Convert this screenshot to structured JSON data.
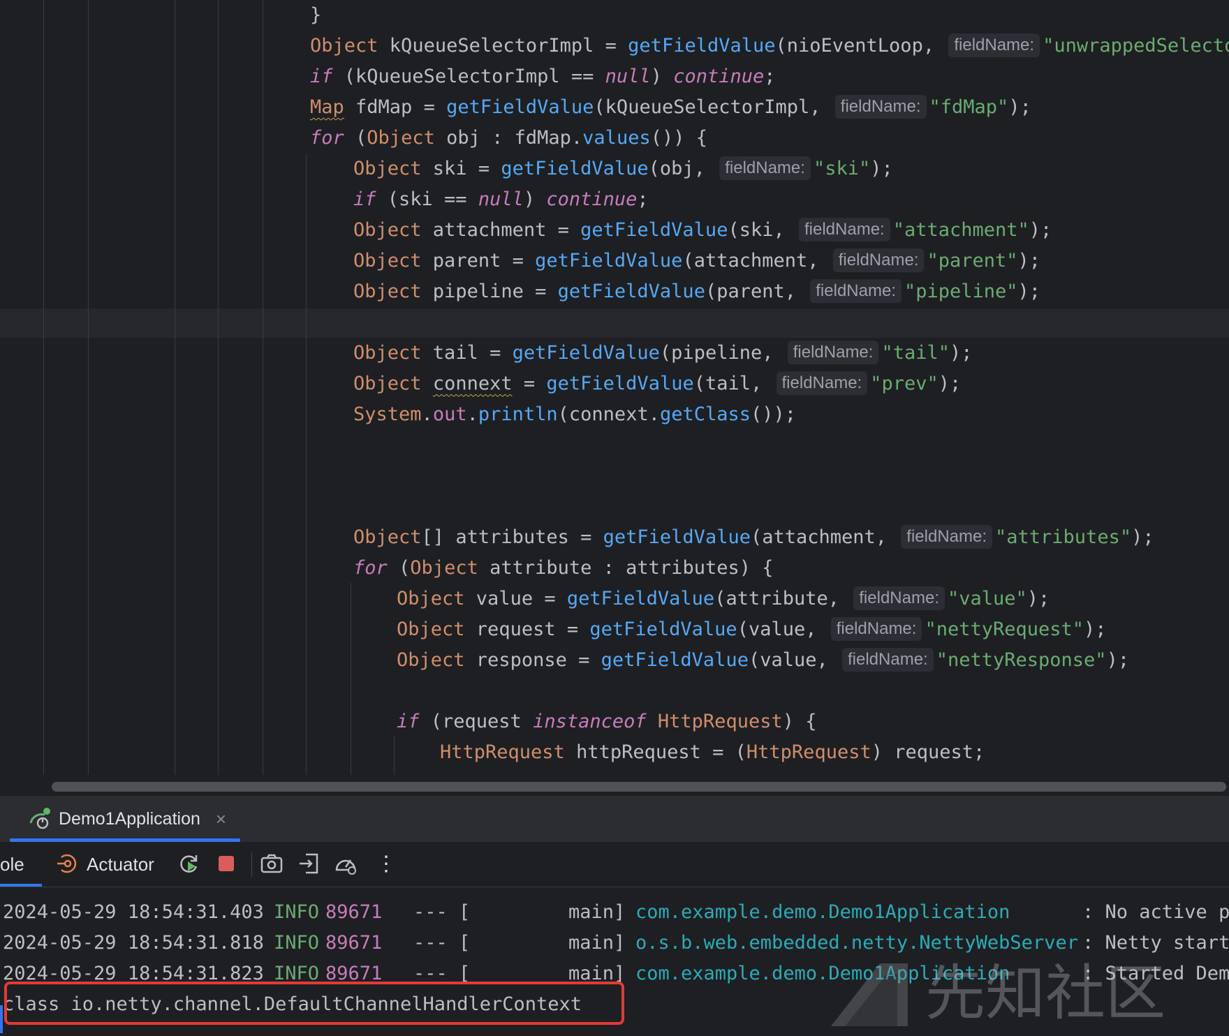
{
  "editor": {
    "lines": [
      [
        {
          "t": "}"
        }
      ],
      [
        {
          "c": "kw",
          "t": "Object"
        },
        {
          "t": " kQueueSelectorImpl = "
        },
        {
          "c": "fn",
          "t": "getFieldValue"
        },
        {
          "t": "(nioEventLoop, "
        },
        {
          "h": "fieldName:"
        },
        {
          "c": "str",
          "t": "\"unwrappedSelector\""
        }
      ],
      [
        {
          "c": "it",
          "t": "if"
        },
        {
          "t": " (kQueueSelectorImpl == "
        },
        {
          "c": "it",
          "t": "null"
        },
        {
          "t": ") "
        },
        {
          "c": "it",
          "t": "continue"
        },
        {
          "t": ";"
        }
      ],
      [
        {
          "c": "kw warn",
          "t": "Map"
        },
        {
          "t": " fdMap = "
        },
        {
          "c": "fn",
          "t": "getFieldValue"
        },
        {
          "t": "(kQueueSelectorImpl, "
        },
        {
          "h": "fieldName:"
        },
        {
          "c": "str",
          "t": "\"fdMap\""
        },
        {
          "t": ");"
        }
      ],
      [
        {
          "c": "it",
          "t": "for"
        },
        {
          "t": " ("
        },
        {
          "c": "kw",
          "t": "Object"
        },
        {
          "t": " obj : fdMap."
        },
        {
          "c": "fn",
          "t": "values"
        },
        {
          "t": "()) {"
        }
      ],
      [
        {
          "c": "kw",
          "t": "Object"
        },
        {
          "t": " ski = "
        },
        {
          "c": "fn",
          "t": "getFieldValue"
        },
        {
          "t": "(obj, "
        },
        {
          "h": "fieldName:"
        },
        {
          "c": "str",
          "t": "\"ski\""
        },
        {
          "t": ");"
        }
      ],
      [
        {
          "c": "it",
          "t": "if"
        },
        {
          "t": " (ski == "
        },
        {
          "c": "it",
          "t": "null"
        },
        {
          "t": ") "
        },
        {
          "c": "it",
          "t": "continue"
        },
        {
          "t": ";"
        }
      ],
      [
        {
          "c": "kw",
          "t": "Object"
        },
        {
          "t": " attachment = "
        },
        {
          "c": "fn",
          "t": "getFieldValue"
        },
        {
          "t": "(ski, "
        },
        {
          "h": "fieldName:"
        },
        {
          "c": "str",
          "t": "\"attachment\""
        },
        {
          "t": ");"
        }
      ],
      [
        {
          "c": "kw",
          "t": "Object"
        },
        {
          "t": " parent = "
        },
        {
          "c": "fn",
          "t": "getFieldValue"
        },
        {
          "t": "(attachment, "
        },
        {
          "h": "fieldName:"
        },
        {
          "c": "str",
          "t": "\"parent\""
        },
        {
          "t": ");"
        }
      ],
      [
        {
          "c": "kw",
          "t": "Object"
        },
        {
          "t": " pipeline = "
        },
        {
          "c": "fn",
          "t": "getFieldValue"
        },
        {
          "t": "(parent, "
        },
        {
          "h": "fieldName:"
        },
        {
          "c": "str",
          "t": "\"pipeline\""
        },
        {
          "t": ");"
        }
      ],
      [
        {
          "c": "kw",
          "t": "Object"
        },
        {
          "t": " tail = "
        },
        {
          "c": "fn",
          "t": "getFieldValue"
        },
        {
          "t": "(pipeline, "
        },
        {
          "h": "fieldName:"
        },
        {
          "c": "str",
          "t": "\"tail\""
        },
        {
          "t": ");"
        }
      ],
      [
        {
          "c": "kw",
          "t": "Object"
        },
        {
          "t": " "
        },
        {
          "c": "warn",
          "t": "connext"
        },
        {
          "t": " = "
        },
        {
          "c": "fn",
          "t": "getFieldValue"
        },
        {
          "t": "(tail, "
        },
        {
          "h": "fieldName:"
        },
        {
          "c": "str",
          "t": "\"prev\""
        },
        {
          "t": ");"
        }
      ],
      [
        {
          "c": "kw",
          "t": "System"
        },
        {
          "t": "."
        },
        {
          "c": "fld",
          "t": "out"
        },
        {
          "t": "."
        },
        {
          "c": "fn",
          "t": "println"
        },
        {
          "t": "(connext."
        },
        {
          "c": "fn",
          "t": "getClass"
        },
        {
          "t": "());"
        }
      ],
      [
        {
          "c": "kw",
          "t": "Object"
        },
        {
          "t": "[] attributes = "
        },
        {
          "c": "fn",
          "t": "getFieldValue"
        },
        {
          "t": "(attachment, "
        },
        {
          "h": "fieldName:"
        },
        {
          "c": "str",
          "t": "\"attributes\""
        },
        {
          "t": ");"
        }
      ],
      [
        {
          "c": "it",
          "t": "for"
        },
        {
          "t": " ("
        },
        {
          "c": "kw",
          "t": "Object"
        },
        {
          "t": " attribute : attributes) {"
        }
      ],
      [
        {
          "c": "kw",
          "t": "Object"
        },
        {
          "t": " value = "
        },
        {
          "c": "fn",
          "t": "getFieldValue"
        },
        {
          "t": "(attribute, "
        },
        {
          "h": "fieldName:"
        },
        {
          "c": "str",
          "t": "\"value\""
        },
        {
          "t": ");"
        }
      ],
      [
        {
          "c": "kw",
          "t": "Object"
        },
        {
          "t": " request = "
        },
        {
          "c": "fn",
          "t": "getFieldValue"
        },
        {
          "t": "(value, "
        },
        {
          "h": "fieldName:"
        },
        {
          "c": "str",
          "t": "\"nettyRequest\""
        },
        {
          "t": ");"
        }
      ],
      [
        {
          "c": "kw",
          "t": "Object"
        },
        {
          "t": " response = "
        },
        {
          "c": "fn",
          "t": "getFieldValue"
        },
        {
          "t": "(value, "
        },
        {
          "h": "fieldName:"
        },
        {
          "c": "str",
          "t": "\"nettyResponse\""
        },
        {
          "t": ");"
        }
      ],
      [
        {
          "c": "it",
          "t": "if"
        },
        {
          "t": " (request "
        },
        {
          "c": "it",
          "t": "instanceof"
        },
        {
          "t": " "
        },
        {
          "c": "kw",
          "t": "HttpRequest"
        },
        {
          "t": ") {"
        }
      ],
      [
        {
          "c": "kw",
          "t": "HttpRequest"
        },
        {
          "t": " httpRequest = ("
        },
        {
          "c": "kw",
          "t": "HttpRequest"
        },
        {
          "t": ") request;"
        }
      ]
    ]
  },
  "run_tab": {
    "label": "Demo1Application",
    "close": "×"
  },
  "toolbar": {
    "console_label": "ole",
    "actuator_label": "Actuator",
    "more": "⋮"
  },
  "console": {
    "log": [
      {
        "ts": "2024-05-29 18:54:31.403",
        "level": "INFO",
        "pid": "89671",
        "sep": "--- [",
        "thread": "main]",
        "logger": "com.example.demo.Demo1Application",
        "msg": ": No active pr"
      },
      {
        "ts": "2024-05-29 18:54:31.818",
        "level": "INFO",
        "pid": "89671",
        "sep": "--- [",
        "thread": "main]",
        "logger": "o.s.b.web.embedded.netty.NettyWebServer",
        "msg": ": Netty starte"
      },
      {
        "ts": "2024-05-29 18:54:31.823",
        "level": "INFO",
        "pid": "89671",
        "sep": "--- [",
        "thread": "main]",
        "logger": "com.example.demo.Demo1Application",
        "msg": ": Started Demo"
      }
    ],
    "output": "class io.netty.channel.DefaultChannelHandlerContext"
  },
  "watermark": {
    "text": "先知社区"
  },
  "colors": {
    "accent": "#3574f0",
    "highlight_box": "#e53935"
  }
}
